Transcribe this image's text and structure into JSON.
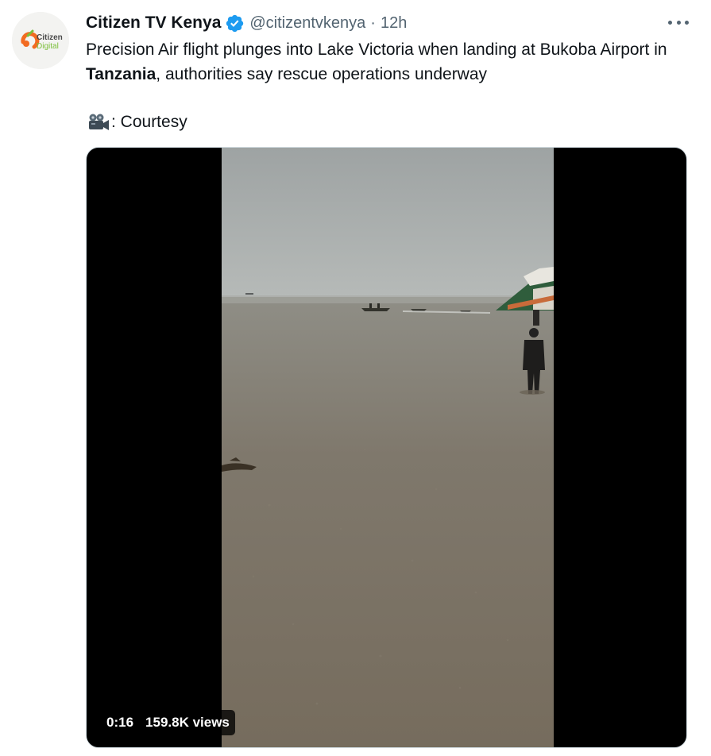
{
  "tweet": {
    "display_name": "Citizen TV Kenya",
    "handle": "@citizentvkenya",
    "separator": "·",
    "time": "12h",
    "text": {
      "part1": "Precision Air flight plunges into Lake Victoria when landing at Bukoba Airport in ",
      "bold": "Tanzania",
      "part2": ", authorities say rescue operations underway"
    },
    "credit": ": Courtesy",
    "avatar": {
      "line1": "Citizen",
      "line2": "Digital"
    },
    "video": {
      "duration": "0:16",
      "views": "159.8K views"
    },
    "icons": {
      "verified": "verified-badge-icon",
      "camera": "movie-camera-icon",
      "more": "more-options-icon"
    },
    "colors": {
      "verified": "#1d9bf0",
      "secondary_text": "#536471",
      "brand_orange": "#f26b21",
      "brand_green": "#7bbf3a"
    }
  }
}
